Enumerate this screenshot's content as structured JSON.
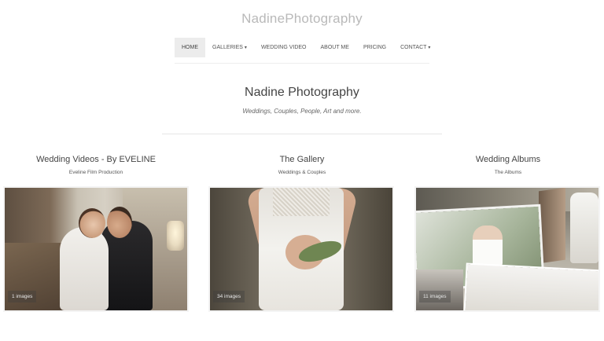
{
  "site": {
    "logo": "NadinePhotography"
  },
  "nav": {
    "items": [
      {
        "label": "HOME",
        "active": true,
        "has_dropdown": false
      },
      {
        "label": "GALLERIES",
        "active": false,
        "has_dropdown": true
      },
      {
        "label": "WEDDING VIDEO",
        "active": false,
        "has_dropdown": false
      },
      {
        "label": "ABOUT ME",
        "active": false,
        "has_dropdown": false
      },
      {
        "label": "PRICING",
        "active": false,
        "has_dropdown": false
      },
      {
        "label": "CONTACT",
        "active": false,
        "has_dropdown": true
      }
    ],
    "caret": "▾"
  },
  "hero": {
    "title": "Nadine Photography",
    "subtitle": "Weddings, Couples, People, Art and more."
  },
  "galleries": [
    {
      "title": "Wedding Videos - By EVELINE",
      "subtitle": "Eveline Film Production",
      "badge": "1 images"
    },
    {
      "title": "The Gallery",
      "subtitle": "Weddings & Couples",
      "badge": "34 images"
    },
    {
      "title": "Wedding Albums",
      "subtitle": "The Albums",
      "badge": "11 images"
    }
  ],
  "colors": {
    "logo": "#b9b9b9",
    "nav_active_bg": "#ececec",
    "text": "#444444",
    "badge_bg": "rgba(60,60,60,0.35)"
  }
}
